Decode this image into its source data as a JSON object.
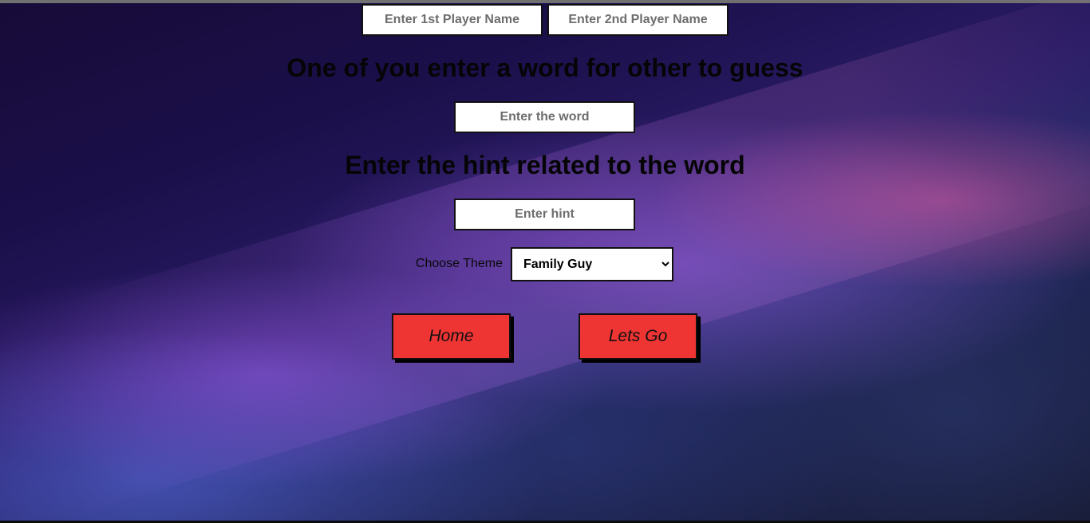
{
  "players": {
    "player1_placeholder": "Enter 1st Player Name",
    "player1_value": "",
    "player2_placeholder": "Enter 2nd Player Name",
    "player2_value": ""
  },
  "word_section": {
    "heading": "One of you enter a word for other to guess",
    "word_placeholder": "Enter the word",
    "word_value": ""
  },
  "hint_section": {
    "heading": "Enter the hint related to the word",
    "hint_placeholder": "Enter hint",
    "hint_value": ""
  },
  "theme": {
    "label": "Choose Theme",
    "selected": "Family Guy"
  },
  "buttons": {
    "home_label": "Home",
    "go_label": "Lets Go"
  },
  "colors": {
    "button_bg": "#ef3434",
    "heading_text": "#050505"
  }
}
